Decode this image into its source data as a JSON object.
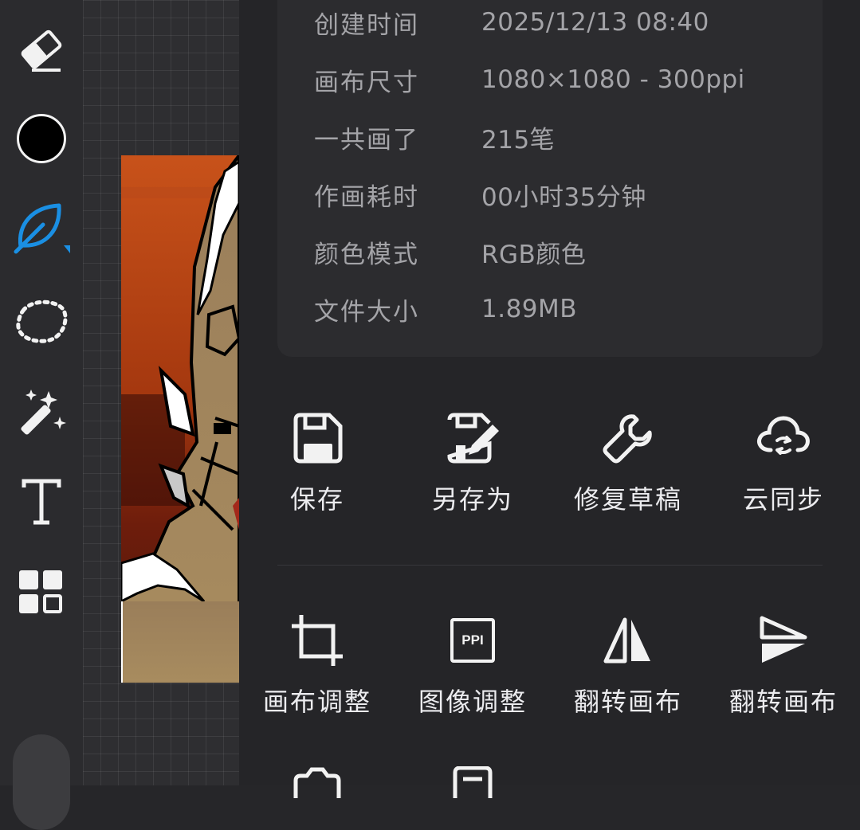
{
  "toolbar": {
    "tools": [
      {
        "id": "eraser",
        "icon": "eraser-icon"
      },
      {
        "id": "color",
        "icon": "color-swatch",
        "color": "#000000"
      },
      {
        "id": "brush",
        "icon": "leaf-brush-icon",
        "active": true,
        "accent": "#1a8fe3"
      },
      {
        "id": "lasso",
        "icon": "lasso-select-icon"
      },
      {
        "id": "magic-wand",
        "icon": "magic-wand-icon"
      },
      {
        "id": "text",
        "icon": "text-icon"
      },
      {
        "id": "layers",
        "icon": "layers-grid-icon"
      }
    ]
  },
  "info": [
    {
      "key": "创建时间",
      "value": "2025/12/13 08:40"
    },
    {
      "key": "画布尺寸",
      "value": "1080×1080 - 300ppi"
    },
    {
      "key": "一共画了",
      "value": "215笔"
    },
    {
      "key": "作画耗时",
      "value": "00小时35分钟"
    },
    {
      "key": "颜色模式",
      "value": "RGB颜色"
    },
    {
      "key": "文件大小",
      "value": "1.89MB"
    }
  ],
  "actions_row1": [
    {
      "label": "保存",
      "icon": "save-icon"
    },
    {
      "label": "另存为",
      "icon": "save-as-icon"
    },
    {
      "label": "修复草稿",
      "icon": "wrench-icon"
    },
    {
      "label": "云同步",
      "icon": "cloud-sync-icon"
    }
  ],
  "actions_row2": [
    {
      "label": "画布调整",
      "icon": "crop-icon"
    },
    {
      "label": "图像调整",
      "icon": "ppi-icon",
      "badge": "PPI"
    },
    {
      "label": "翻转画布",
      "icon": "flip-horizontal-icon"
    },
    {
      "label": "翻转画布",
      "icon": "flip-vertical-icon"
    }
  ],
  "colors": {
    "panel": "#252528",
    "card": "#2c2c2f",
    "text_muted": "#a4a4a8",
    "text": "#ececef",
    "accent": "#1a8fe3"
  }
}
